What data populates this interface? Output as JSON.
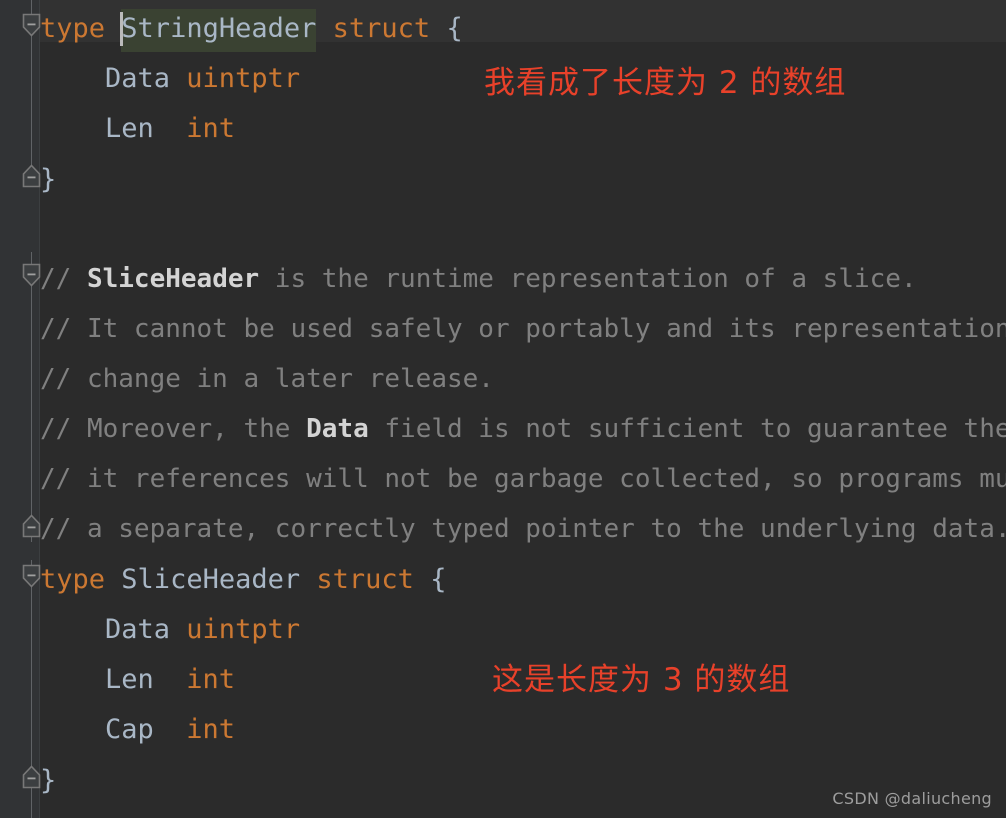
{
  "editor": {
    "background": "#2b2b2b",
    "gutter_background": "#313335",
    "caret_line_background": "#323232",
    "keyword_color": "#cc7832",
    "identifier_color": "#a9b7c6",
    "comment_color": "#808080",
    "annotation_color": "#e8412a",
    "selection_highlight_color": "#3a4232"
  },
  "code": {
    "line1": {
      "kw_type": "type",
      "name": "StringHeader",
      "kw_struct": "struct",
      "brace": "{"
    },
    "line2": {
      "field": "Data",
      "type": "uintptr"
    },
    "line3": {
      "field": "Len",
      "type": "int"
    },
    "line4": {
      "brace": "}"
    },
    "line6": {
      "prefix": "// ",
      "bold": "SliceHeader",
      "rest": " is the runtime representation of a slice."
    },
    "line7": {
      "text": "// It cannot be used safely or portably and its representation"
    },
    "line8": {
      "text": "// change in a later release."
    },
    "line9": {
      "prefix": "// Moreover, the ",
      "bold": "Data",
      "rest": " field is not sufficient to guarantee the"
    },
    "line10": {
      "text": "// it references will not be garbage collected, so programs mu"
    },
    "line11": {
      "text": "// a separate, correctly typed pointer to the underlying data."
    },
    "line12": {
      "kw_type": "type",
      "name": "SliceHeader",
      "kw_struct": "struct",
      "brace": "{"
    },
    "line13": {
      "field": "Data",
      "type": "uintptr"
    },
    "line14": {
      "field": "Len",
      "type": "int"
    },
    "line15": {
      "field": "Cap",
      "type": "int"
    },
    "line16": {
      "brace": "}"
    }
  },
  "annotations": {
    "top": "我看成了长度为 2 的数组",
    "bottom": "这是长度为 3 的数组"
  },
  "watermark": {
    "text": "CSDN @daliucheng"
  },
  "gutter": {
    "fold_marker_icon": "fold-collapse-icon",
    "fold_end_marker_icon": "fold-end-icon"
  }
}
